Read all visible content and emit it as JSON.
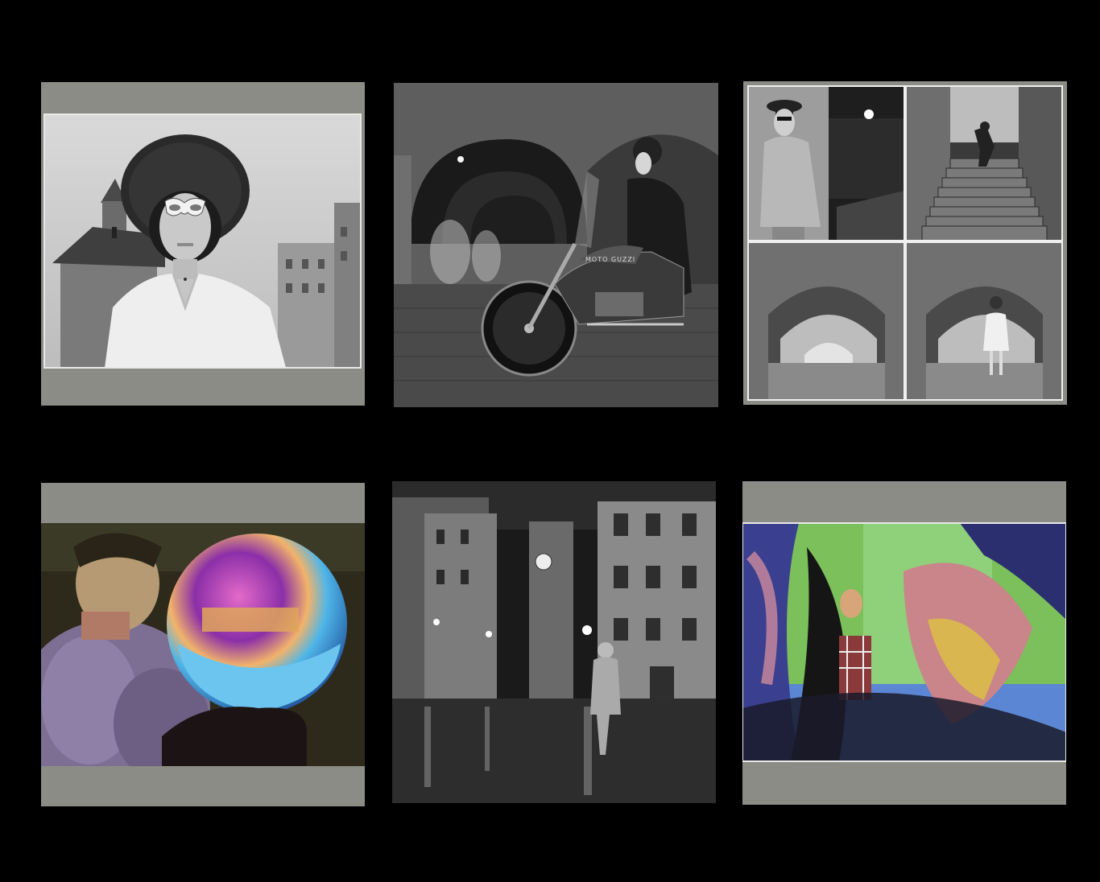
{
  "gallery": {
    "background": "#000000",
    "frame_color": "#8b8c86",
    "tiles": [
      {
        "name": "woman-hat-sunglasses-photo",
        "tone": "black-and-white",
        "matted": true
      },
      {
        "name": "motorcycle-arcade-photo",
        "tone": "black-and-white",
        "matted": false,
        "text": {
          "bike_brand": "MOTO GUZZI"
        }
      },
      {
        "name": "four-panel-noir-collage",
        "tone": "black-and-white",
        "matted": true,
        "panels": 4
      },
      {
        "name": "woman-crystal-ball-photo",
        "tone": "hand-colored",
        "matted": true
      },
      {
        "name": "rainy-night-square-photo",
        "tone": "black-and-white",
        "matted": false
      },
      {
        "name": "distorted-reflection-photo",
        "tone": "color",
        "matted": true
      }
    ]
  }
}
